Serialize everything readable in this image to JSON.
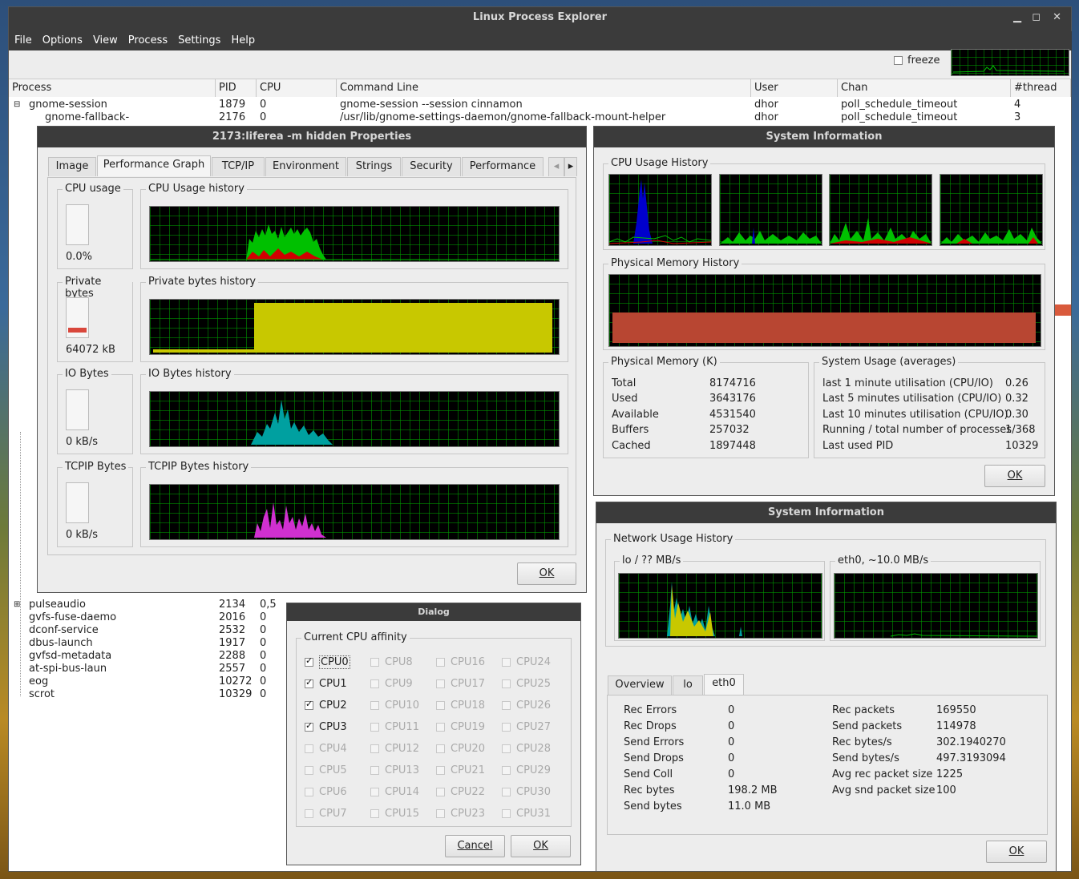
{
  "main": {
    "title": "Linux Process Explorer",
    "menu": [
      "File",
      "Options",
      "View",
      "Process",
      "Settings",
      "Help"
    ],
    "freeze_label": "freeze",
    "columns": [
      "Process",
      "PID",
      "CPU",
      "Command Line",
      "User",
      "Chan",
      "#thread"
    ],
    "rows_top": [
      {
        "name": "gnome-session",
        "pid": "1879",
        "cpu": "0",
        "cmd": "gnome-session --session cinnamon",
        "user": "dhor",
        "chan": "poll_schedule_timeout",
        "threads": "4"
      },
      {
        "name": "gnome-fallback-",
        "pid": "2176",
        "cpu": "0",
        "cmd": "/usr/lib/gnome-settings-daemon/gnome-fallback-mount-helper",
        "user": "dhor",
        "chan": "poll_schedule_timeout",
        "threads": "3"
      }
    ],
    "rows_bottom": [
      {
        "name": "pulseaudio",
        "pid": "2134",
        "cpu": "0,5"
      },
      {
        "name": "gvfs-fuse-daemo",
        "pid": "2016",
        "cpu": "0"
      },
      {
        "name": "dconf-service",
        "pid": "2532",
        "cpu": "0"
      },
      {
        "name": "dbus-launch",
        "pid": "1917",
        "cpu": "0"
      },
      {
        "name": "gvfsd-metadata",
        "pid": "2288",
        "cpu": "0"
      },
      {
        "name": "at-spi-bus-laun",
        "pid": "2557",
        "cpu": "0"
      },
      {
        "name": "eog",
        "pid": "10272",
        "cpu": "0"
      },
      {
        "name": "scrot",
        "pid": "10329",
        "cpu": "0"
      }
    ]
  },
  "props": {
    "title": "2173:liferea -m hidden  Properties",
    "tabs": [
      "Image",
      "Performance Graph",
      "TCP/IP",
      "Environment",
      "Strings",
      "Security",
      "Performance"
    ],
    "cpu_usage_label": "CPU usage",
    "cpu_usage_value": "0.0%",
    "cpu_usage_fraction": 0.0,
    "cpu_history_label": "CPU Usage history",
    "private_label": "Private bytes",
    "private_value": "64072 kB",
    "private_history_label": "Private bytes history",
    "io_label": "IO Bytes",
    "io_value": "0 kB/s",
    "io_history_label": "IO Bytes history",
    "tcpip_label": "TCPIP Bytes",
    "tcpip_value": "0 kB/s",
    "tcpip_history_label": "TCPIP Bytes history",
    "ok": "OK"
  },
  "sysinfo": {
    "title": "System Information",
    "cpu_history_label": "CPU Usage History",
    "mem_history_label": "Physical Memory History",
    "phys_label": "Physical Memory (K)",
    "phys": [
      {
        "k": "Total",
        "v": "8174716"
      },
      {
        "k": "Used",
        "v": "3643176"
      },
      {
        "k": "Available",
        "v": "4531540"
      },
      {
        "k": "Buffers",
        "v": "257032"
      },
      {
        "k": "Cached",
        "v": "1897448"
      }
    ],
    "usage_label": "System Usage (averages)",
    "usage": [
      {
        "k": "last 1 minute utilisation (CPU/IO)",
        "v": "0.26"
      },
      {
        "k": "Last 5 minutes utilisation (CPU/IO)",
        "v": "0.32"
      },
      {
        "k": "Last 10 minutes utilisation (CPU/IO)",
        "v": "0.30"
      },
      {
        "k": "Running / total number of processes",
        "v": "1/368"
      },
      {
        "k": "Last used PID",
        "v": "10329"
      }
    ],
    "ok": "OK"
  },
  "net": {
    "title": "System Information",
    "history_label": "Network Usage History",
    "lo_label": "lo / ?? MB/s",
    "eth_label": "eth0, ~10.0 MB/s",
    "tabs": [
      "Overview",
      "lo",
      "eth0"
    ],
    "left": [
      {
        "k": "Rec Errors",
        "v": "0"
      },
      {
        "k": "Rec Drops",
        "v": "0"
      },
      {
        "k": "Send Errors",
        "v": "0"
      },
      {
        "k": "Send Drops",
        "v": "0"
      },
      {
        "k": "Send Coll",
        "v": "0"
      },
      {
        "k": "Rec bytes",
        "v": "198.2 MB"
      },
      {
        "k": "Send bytes",
        "v": "11.0 MB"
      }
    ],
    "right": [
      {
        "k": "Rec packets",
        "v": "169550"
      },
      {
        "k": "Send packets",
        "v": "114978"
      },
      {
        "k": "Rec bytes/s",
        "v": "302.1940270"
      },
      {
        "k": "Send bytes/s",
        "v": "497.3193094"
      },
      {
        "k": "Avg rec packet size",
        "v": "1225"
      },
      {
        "k": "Avg snd packet size",
        "v": "100"
      }
    ],
    "ok": "OK"
  },
  "dialog": {
    "title": "Dialog",
    "group": "Current CPU affinity",
    "cpus": [
      {
        "label": "CPU0",
        "checked": true,
        "enabled": true
      },
      {
        "label": "CPU1",
        "checked": true,
        "enabled": true
      },
      {
        "label": "CPU2",
        "checked": true,
        "enabled": true
      },
      {
        "label": "CPU3",
        "checked": true,
        "enabled": true
      },
      {
        "label": "CPU4",
        "checked": false,
        "enabled": false
      },
      {
        "label": "CPU5",
        "checked": false,
        "enabled": false
      },
      {
        "label": "CPU6",
        "checked": false,
        "enabled": false
      },
      {
        "label": "CPU7",
        "checked": false,
        "enabled": false
      },
      {
        "label": "CPU8",
        "checked": false,
        "enabled": false
      },
      {
        "label": "CPU9",
        "checked": false,
        "enabled": false
      },
      {
        "label": "CPU10",
        "checked": false,
        "enabled": false
      },
      {
        "label": "CPU11",
        "checked": false,
        "enabled": false
      },
      {
        "label": "CPU12",
        "checked": false,
        "enabled": false
      },
      {
        "label": "CPU13",
        "checked": false,
        "enabled": false
      },
      {
        "label": "CPU14",
        "checked": false,
        "enabled": false
      },
      {
        "label": "CPU15",
        "checked": false,
        "enabled": false
      },
      {
        "label": "CPU16",
        "checked": false,
        "enabled": false
      },
      {
        "label": "CPU17",
        "checked": false,
        "enabled": false
      },
      {
        "label": "CPU18",
        "checked": false,
        "enabled": false
      },
      {
        "label": "CPU19",
        "checked": false,
        "enabled": false
      },
      {
        "label": "CPU20",
        "checked": false,
        "enabled": false
      },
      {
        "label": "CPU21",
        "checked": false,
        "enabled": false
      },
      {
        "label": "CPU22",
        "checked": false,
        "enabled": false
      },
      {
        "label": "CPU23",
        "checked": false,
        "enabled": false
      },
      {
        "label": "CPU24",
        "checked": false,
        "enabled": false
      },
      {
        "label": "CPU25",
        "checked": false,
        "enabled": false
      },
      {
        "label": "CPU26",
        "checked": false,
        "enabled": false
      },
      {
        "label": "CPU27",
        "checked": false,
        "enabled": false
      },
      {
        "label": "CPU28",
        "checked": false,
        "enabled": false
      },
      {
        "label": "CPU29",
        "checked": false,
        "enabled": false
      },
      {
        "label": "CPU30",
        "checked": false,
        "enabled": false
      },
      {
        "label": "CPU31",
        "checked": false,
        "enabled": false
      }
    ],
    "cancel": "Cancel",
    "ok": "OK"
  },
  "colors": {
    "cpu": "#00c000",
    "kernel": "#d00000",
    "private": "#c8c800",
    "io": "#00a0a0",
    "tcpip": "#d030d0",
    "memory": "#b84632",
    "cpu0": "#0000cc"
  }
}
